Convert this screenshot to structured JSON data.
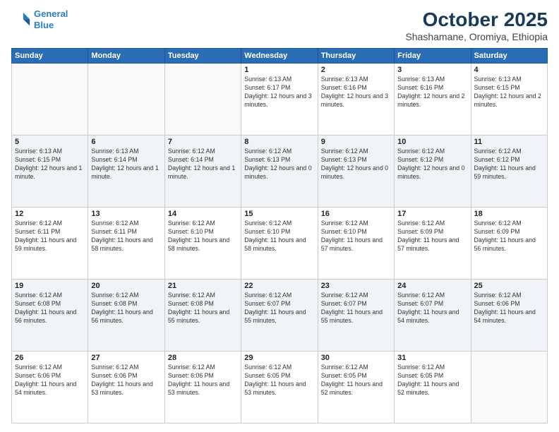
{
  "header": {
    "logo_line1": "General",
    "logo_line2": "Blue",
    "month": "October 2025",
    "location": "Shashamane, Oromiya, Ethiopia"
  },
  "days_of_week": [
    "Sunday",
    "Monday",
    "Tuesday",
    "Wednesday",
    "Thursday",
    "Friday",
    "Saturday"
  ],
  "weeks": [
    [
      {
        "day": "",
        "text": ""
      },
      {
        "day": "",
        "text": ""
      },
      {
        "day": "",
        "text": ""
      },
      {
        "day": "1",
        "text": "Sunrise: 6:13 AM\nSunset: 6:17 PM\nDaylight: 12 hours and 3 minutes."
      },
      {
        "day": "2",
        "text": "Sunrise: 6:13 AM\nSunset: 6:16 PM\nDaylight: 12 hours and 3 minutes."
      },
      {
        "day": "3",
        "text": "Sunrise: 6:13 AM\nSunset: 6:16 PM\nDaylight: 12 hours and 2 minutes."
      },
      {
        "day": "4",
        "text": "Sunrise: 6:13 AM\nSunset: 6:15 PM\nDaylight: 12 hours and 2 minutes."
      }
    ],
    [
      {
        "day": "5",
        "text": "Sunrise: 6:13 AM\nSunset: 6:15 PM\nDaylight: 12 hours and 1 minute."
      },
      {
        "day": "6",
        "text": "Sunrise: 6:13 AM\nSunset: 6:14 PM\nDaylight: 12 hours and 1 minute."
      },
      {
        "day": "7",
        "text": "Sunrise: 6:12 AM\nSunset: 6:14 PM\nDaylight: 12 hours and 1 minute."
      },
      {
        "day": "8",
        "text": "Sunrise: 6:12 AM\nSunset: 6:13 PM\nDaylight: 12 hours and 0 minutes."
      },
      {
        "day": "9",
        "text": "Sunrise: 6:12 AM\nSunset: 6:13 PM\nDaylight: 12 hours and 0 minutes."
      },
      {
        "day": "10",
        "text": "Sunrise: 6:12 AM\nSunset: 6:12 PM\nDaylight: 12 hours and 0 minutes."
      },
      {
        "day": "11",
        "text": "Sunrise: 6:12 AM\nSunset: 6:12 PM\nDaylight: 11 hours and 59 minutes."
      }
    ],
    [
      {
        "day": "12",
        "text": "Sunrise: 6:12 AM\nSunset: 6:11 PM\nDaylight: 11 hours and 59 minutes."
      },
      {
        "day": "13",
        "text": "Sunrise: 6:12 AM\nSunset: 6:11 PM\nDaylight: 11 hours and 58 minutes."
      },
      {
        "day": "14",
        "text": "Sunrise: 6:12 AM\nSunset: 6:10 PM\nDaylight: 11 hours and 58 minutes."
      },
      {
        "day": "15",
        "text": "Sunrise: 6:12 AM\nSunset: 6:10 PM\nDaylight: 11 hours and 58 minutes."
      },
      {
        "day": "16",
        "text": "Sunrise: 6:12 AM\nSunset: 6:10 PM\nDaylight: 11 hours and 57 minutes."
      },
      {
        "day": "17",
        "text": "Sunrise: 6:12 AM\nSunset: 6:09 PM\nDaylight: 11 hours and 57 minutes."
      },
      {
        "day": "18",
        "text": "Sunrise: 6:12 AM\nSunset: 6:09 PM\nDaylight: 11 hours and 56 minutes."
      }
    ],
    [
      {
        "day": "19",
        "text": "Sunrise: 6:12 AM\nSunset: 6:08 PM\nDaylight: 11 hours and 56 minutes."
      },
      {
        "day": "20",
        "text": "Sunrise: 6:12 AM\nSunset: 6:08 PM\nDaylight: 11 hours and 56 minutes."
      },
      {
        "day": "21",
        "text": "Sunrise: 6:12 AM\nSunset: 6:08 PM\nDaylight: 11 hours and 55 minutes."
      },
      {
        "day": "22",
        "text": "Sunrise: 6:12 AM\nSunset: 6:07 PM\nDaylight: 11 hours and 55 minutes."
      },
      {
        "day": "23",
        "text": "Sunrise: 6:12 AM\nSunset: 6:07 PM\nDaylight: 11 hours and 55 minutes."
      },
      {
        "day": "24",
        "text": "Sunrise: 6:12 AM\nSunset: 6:07 PM\nDaylight: 11 hours and 54 minutes."
      },
      {
        "day": "25",
        "text": "Sunrise: 6:12 AM\nSunset: 6:06 PM\nDaylight: 11 hours and 54 minutes."
      }
    ],
    [
      {
        "day": "26",
        "text": "Sunrise: 6:12 AM\nSunset: 6:06 PM\nDaylight: 11 hours and 54 minutes."
      },
      {
        "day": "27",
        "text": "Sunrise: 6:12 AM\nSunset: 6:06 PM\nDaylight: 11 hours and 53 minutes."
      },
      {
        "day": "28",
        "text": "Sunrise: 6:12 AM\nSunset: 6:06 PM\nDaylight: 11 hours and 53 minutes."
      },
      {
        "day": "29",
        "text": "Sunrise: 6:12 AM\nSunset: 6:05 PM\nDaylight: 11 hours and 53 minutes."
      },
      {
        "day": "30",
        "text": "Sunrise: 6:12 AM\nSunset: 6:05 PM\nDaylight: 11 hours and 52 minutes."
      },
      {
        "day": "31",
        "text": "Sunrise: 6:12 AM\nSunset: 6:05 PM\nDaylight: 11 hours and 52 minutes."
      },
      {
        "day": "",
        "text": ""
      }
    ]
  ]
}
